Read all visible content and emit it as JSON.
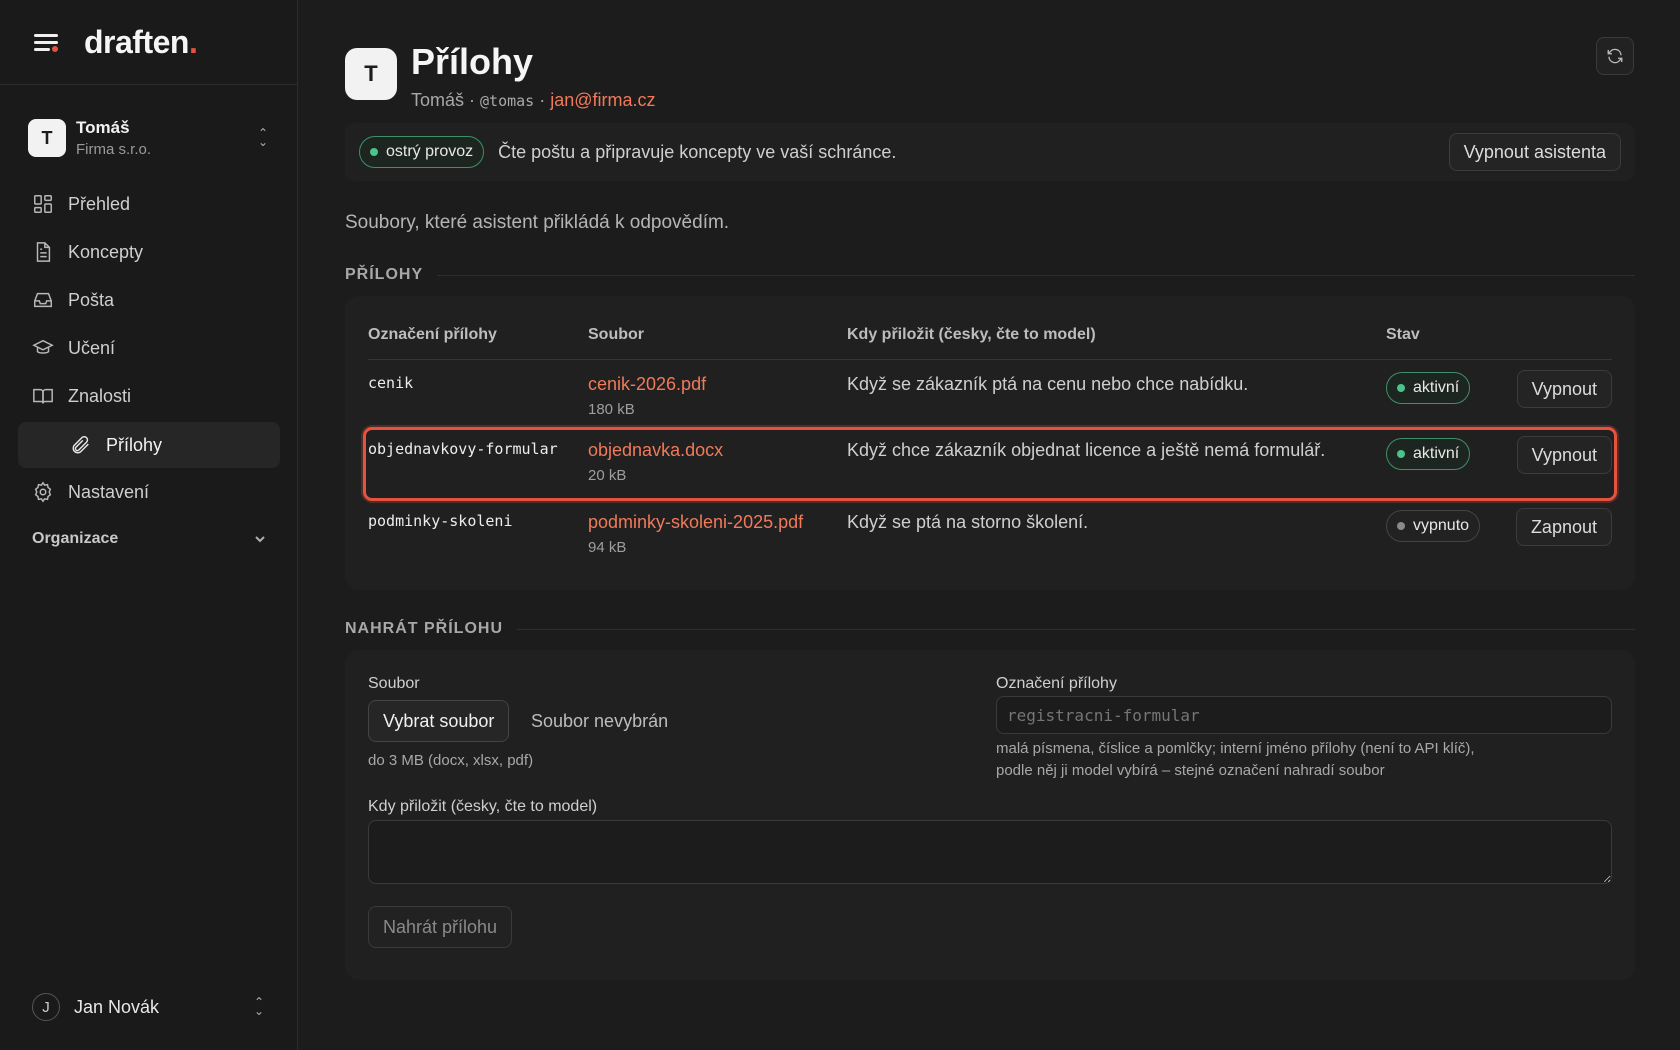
{
  "brand": {
    "name": "draften",
    "dot": "."
  },
  "account": {
    "initial": "T",
    "name": "Tomáš",
    "org": "Firma s.r.o."
  },
  "nav": {
    "items": [
      {
        "label": "Přehled",
        "icon": "dashboard-icon"
      },
      {
        "label": "Koncepty",
        "icon": "document-icon"
      },
      {
        "label": "Pošta",
        "icon": "inbox-icon"
      },
      {
        "label": "Učení",
        "icon": "graduation-cap-icon"
      },
      {
        "label": "Znalosti",
        "icon": "book-icon"
      }
    ],
    "sub_item": {
      "label": "Přílohy",
      "icon": "paperclip-icon"
    },
    "settings": {
      "label": "Nastavení",
      "icon": "gear-icon"
    },
    "group": "Organizace"
  },
  "user": {
    "initial": "J",
    "name": "Jan Novák"
  },
  "header": {
    "initial": "T",
    "title": "Přílohy",
    "name": "Tomáš",
    "sep": " · ",
    "handle": "@tomas",
    "email": "jan@firma.cz"
  },
  "banner": {
    "status": "ostrý provoz",
    "text": "Čte poštu a připravuje koncepty ve vaší schránce.",
    "button": "Vypnout asistenta"
  },
  "intro": "Soubory, které asistent přikládá k odpovědím.",
  "attachments": {
    "section_label": "PŘÍLOHY",
    "columns": [
      "Označení přílohy",
      "Soubor",
      "Kdy přiložit (česky, čte to model)",
      "Stav"
    ],
    "rows": [
      {
        "key": "cenik",
        "file": "cenik-2026.pdf",
        "size": "180 kB",
        "when": "Když se zákazník ptá na cenu nebo chce nabídku.",
        "status": "aktivní",
        "action": "Vypnout"
      },
      {
        "key": "objednavkovy-formular",
        "file": "objednavka.docx",
        "size": "20 kB",
        "when": "Když chce zákazník objednat licence a ještě nemá formulář.",
        "status": "aktivní",
        "action": "Vypnout"
      },
      {
        "key": "podminky-skoleni",
        "file": "podminky-skoleni-2025.pdf",
        "size": "94 kB",
        "when": "Když se ptá na storno školení.",
        "status": "vypnuto",
        "action": "Zapnout"
      }
    ]
  },
  "upload": {
    "section_label": "NAHRÁT PŘÍLOHU",
    "file_label": "Soubor",
    "choose_button": "Vybrat soubor",
    "no_file": "Soubor nevybrán",
    "file_hint": "do 3 MB (docx, xlsx, pdf)",
    "key_label": "Označení přílohy",
    "key_placeholder": "registracni-formular",
    "key_hint_1": "malá písmena, číslice a pomlčky; interní jméno přílohy (není to API klíč),",
    "key_hint_2": "podle něj ji model vybírá – stejné označení nahradí soubor",
    "when_label": "Kdy přiložit (česky, čte to model)",
    "submit": "Nahrát přílohu"
  },
  "colors": {
    "accent": "#e5533f",
    "link": "#f07a5a",
    "active": "#4cc38a"
  }
}
